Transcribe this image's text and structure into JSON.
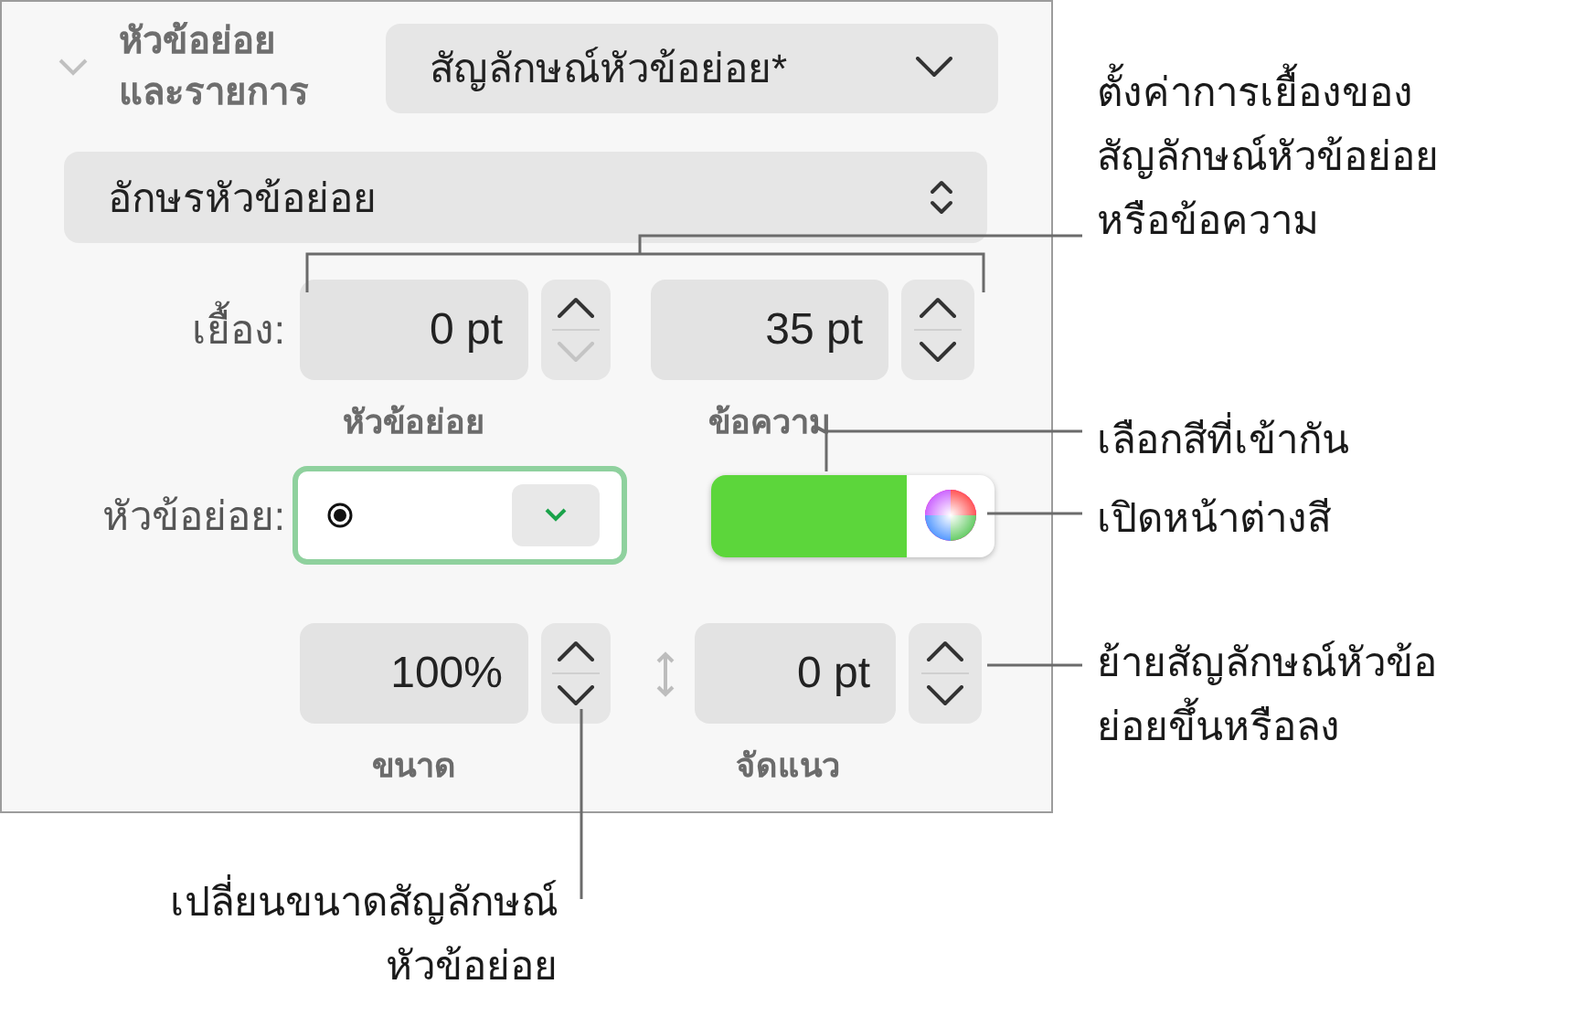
{
  "section": {
    "title_lines": [
      "หัวข้อย่อย",
      "และรายการ"
    ],
    "expanded": true
  },
  "list_style": {
    "value": "สัญลักษณ์หัวข้อย่อย*"
  },
  "bullet_type": {
    "value": "อักษรหัวข้อย่อย"
  },
  "indent": {
    "label": "เยื้อง:",
    "fields": [
      {
        "value": "0 pt",
        "caption": "หัวข้อย่อย",
        "decrement_disabled": true
      },
      {
        "value": "35 pt",
        "caption": "ข้อความ",
        "decrement_disabled": false
      }
    ]
  },
  "bullet": {
    "label": "หัวข้อย่อย:",
    "focused": true,
    "color": "#5cd63b"
  },
  "size": {
    "value": "100%",
    "caption": "ขนาด"
  },
  "align": {
    "value": "0 pt",
    "caption": "จัดแนว"
  },
  "callouts": [
    {
      "lines": [
        "ตั้งค่าการเยื้องของ",
        "สัญลักษณ์หัวข้อย่อย",
        "หรือข้อความ"
      ]
    },
    {
      "lines": [
        "เลือกสีที่เข้ากัน"
      ]
    },
    {
      "lines": [
        "เปิดหน้าต่างสี"
      ]
    },
    {
      "lines": [
        "ย้ายสัญลักษณ์หัวข้อ",
        "ย่อยขึ้นหรือลง"
      ]
    },
    {
      "lines": [
        "เปลี่ยนขนาดสัญลักษณ์",
        "หัวข้อย่อย"
      ]
    }
  ]
}
